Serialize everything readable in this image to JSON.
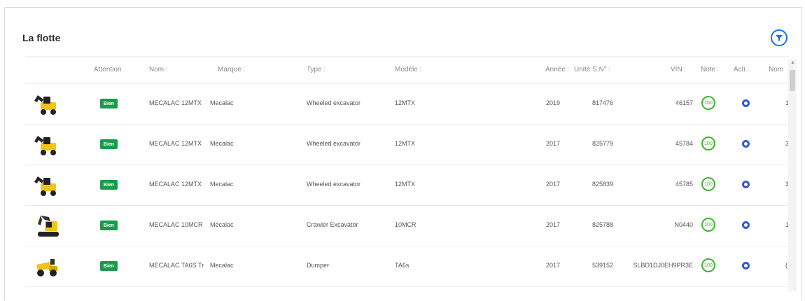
{
  "panel": {
    "title": "La flotte"
  },
  "icons": {
    "filter": "filter-icon",
    "sort": "sort-icon"
  },
  "colors": {
    "accent": "#1f6fe0",
    "status_good": "#1a9a4a",
    "score": "#44b035",
    "action": "#3456d8"
  },
  "columns": {
    "attention": "Attention",
    "nom": "Nom",
    "marque": "Marque",
    "type": "Type",
    "modele": "Modèle",
    "annee": "Année",
    "unite": "Unité S.N°",
    "vin": "VIN",
    "note": "Note",
    "actions": "Acti...",
    "nom2": "Nom",
    "sort_glyph": "⁝"
  },
  "rows": [
    {
      "image": "wheeled-excavator",
      "attention": "Bien",
      "nom": "MECALAC 12MTX",
      "marque": "Mecalac",
      "type": "Wheeled excavator",
      "modele": "12MTX",
      "annee": "2019",
      "unite": "817476",
      "vin": "46157",
      "note": "100",
      "extra": "1"
    },
    {
      "image": "wheeled-excavator",
      "attention": "Bien",
      "nom": "MECALAC 12MTX",
      "marque": "Mecalac",
      "type": "Wheeled excavator",
      "modele": "12MTX",
      "annee": "2017",
      "unite": "825779",
      "vin": "45784",
      "note": "100",
      "extra": "3"
    },
    {
      "image": "wheeled-excavator",
      "attention": "Bien",
      "nom": "MECALAC 12MTX",
      "marque": "Mecalac",
      "type": "Wheeled excavator",
      "modele": "12MTX",
      "annee": "2017",
      "unite": "825839",
      "vin": "45785",
      "note": "100",
      "extra": "3"
    },
    {
      "image": "crawler-excavator",
      "attention": "Bien",
      "nom": "MECALAC 10MCR",
      "marque": "Mecalac",
      "type": "Crawler Excavator",
      "modele": "10MCR",
      "annee": "2017",
      "unite": "825788",
      "vin": "N0440",
      "note": "100",
      "extra": "1"
    },
    {
      "image": "dumper",
      "attention": "Bien",
      "nom": "MECALAC TA6S Tr",
      "marque": "Mecalac",
      "type": "Dumper",
      "modele": "TA6s",
      "annee": "2017",
      "unite": "539152",
      "vin": "SLBD1DJ0EH9PR3E",
      "note": "100",
      "extra": "("
    }
  ]
}
